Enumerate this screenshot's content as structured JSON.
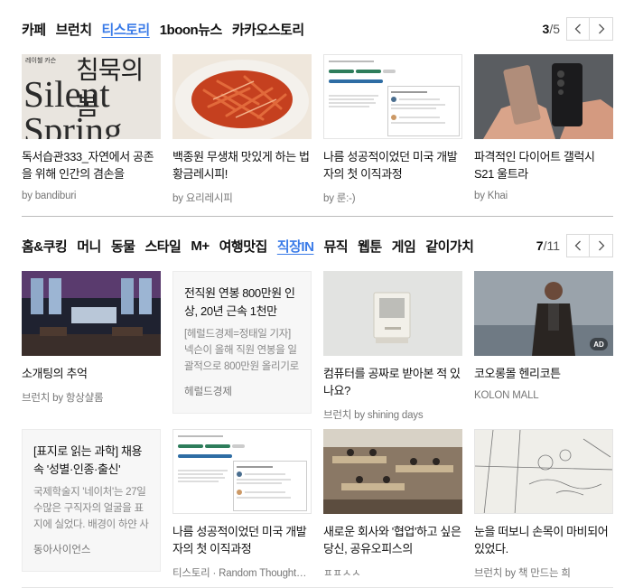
{
  "section1": {
    "tabs": [
      "카페",
      "브런치",
      "티스토리",
      "1boon뉴스",
      "카카오스토리"
    ],
    "active_tab": 2,
    "page_current": "3",
    "page_total": "/5",
    "cards": [
      {
        "title": "독서습관333_자연에서 공존을 위해 인간의 겸손을",
        "byline": "by bandiburi",
        "thumb_text": [
          "레이첼 카슨",
          "침묵의 봄",
          "Silent",
          "Spring"
        ]
      },
      {
        "title": "백종원 무생채 맛있게 하는 법 황금레시피!",
        "byline": "by 요리레시피"
      },
      {
        "title": "나름 성공적이었던 미국 개발자의 첫 이직과정",
        "byline": "by 룬:-)"
      },
      {
        "title": "파격적인 다이어트 갤럭시S21 울트라",
        "byline": "by Khai"
      }
    ]
  },
  "section2": {
    "tabs": [
      "홈&쿠킹",
      "머니",
      "동물",
      "스타일",
      "M+",
      "여행맛집",
      "직장IN",
      "뮤직",
      "웹툰",
      "게임",
      "같이가치"
    ],
    "active_tab": 6,
    "page_current": "7",
    "page_total": "/11",
    "row1": [
      {
        "type": "image",
        "title": "소개팅의 추억",
        "byline": "브런치 by 항상샬롬"
      },
      {
        "type": "text",
        "title": "전직원 연봉 800만원 인상, 20년 근속 1천만",
        "body": "[헤럴드경제=정태일 기자] 넥슨이 올해 직원 연봉을 일괄적으로 800만원 올리기로 했다.",
        "source": "헤럴드경제"
      },
      {
        "type": "image",
        "title": "컴퓨터를 공짜로 받아본 적 있나요?",
        "byline": "브런치 by shining days"
      },
      {
        "type": "image",
        "title": "코오롱몰 헨리코튼",
        "byline": "KOLON MALL",
        "badge": "AD"
      }
    ],
    "row2": [
      {
        "type": "text",
        "title": "[표지로 읽는 과학] 채용 속 '성별·인종·출신'",
        "body": "국제학술지 '네이처'는 27일 수많은 구직자의 얼굴을 표지에 실었다. 배경이 하얀 사진은 선",
        "source": "동아사이언스"
      },
      {
        "type": "image",
        "title": "나름 성공적이었던 미국 개발자의 첫 이직과정",
        "byline": "티스토리 · Random Thought…"
      },
      {
        "type": "image",
        "title": "새로운 회사와 '협업'하고 싶은 당신, 공유오피스의",
        "byline": "ㅍㅍㅅㅅ"
      },
      {
        "type": "image",
        "title": "눈을 떠보니 손목이 마비되어 있었다.",
        "byline": "브런치 by 책 만드는 희"
      }
    ]
  },
  "colors": {
    "accent": "#3a7be8",
    "divider": "#bcbcbc"
  }
}
